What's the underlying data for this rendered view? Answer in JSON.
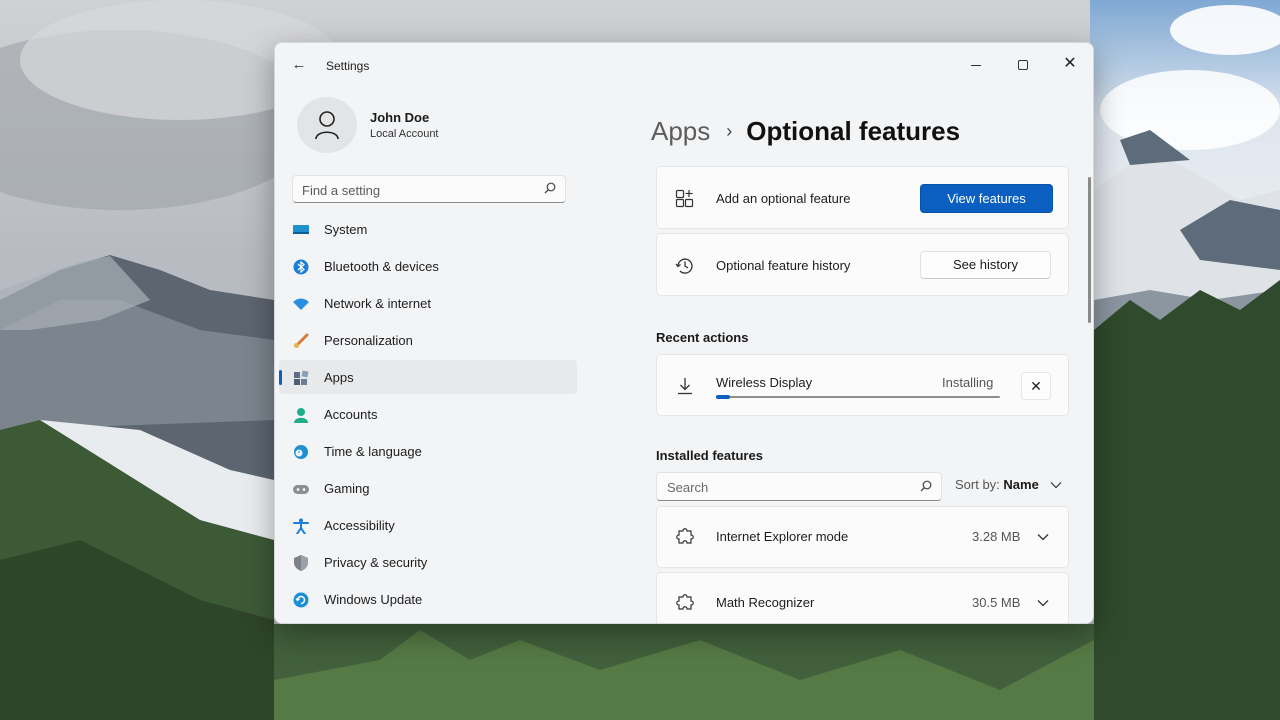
{
  "window": {
    "title": "Settings",
    "back_glyph": "←",
    "close_glyph": "✕"
  },
  "profile": {
    "name": "John Doe",
    "account_type": "Local Account"
  },
  "sidebar": {
    "search_placeholder": "Find a setting",
    "items": [
      {
        "label": "System",
        "icon": "system-icon",
        "color": "#1f8fd0"
      },
      {
        "label": "Bluetooth & devices",
        "icon": "bluetooth-icon",
        "color": "#1a7fd6"
      },
      {
        "label": "Network & internet",
        "icon": "wifi-icon",
        "color": "#2a8fe0"
      },
      {
        "label": "Personalization",
        "icon": "brush-icon",
        "color": "#d77a3a"
      },
      {
        "label": "Apps",
        "icon": "apps-icon",
        "color": "#4a6a8a",
        "active": true
      },
      {
        "label": "Accounts",
        "icon": "person-icon",
        "color": "#1fae8a"
      },
      {
        "label": "Time & language",
        "icon": "globe-clock-icon",
        "color": "#1f8fd0"
      },
      {
        "label": "Gaming",
        "icon": "gamepad-icon",
        "color": "#8a8f96"
      },
      {
        "label": "Accessibility",
        "icon": "accessibility-icon",
        "color": "#1a7fd6"
      },
      {
        "label": "Privacy & security",
        "icon": "shield-icon",
        "color": "#7d8288"
      },
      {
        "label": "Windows Update",
        "icon": "refresh-icon",
        "color": "#1a8fd6"
      }
    ]
  },
  "breadcrumb": {
    "parent": "Apps",
    "separator": "›",
    "current": "Optional features"
  },
  "add_feature": {
    "label": "Add an optional feature",
    "button": "View features"
  },
  "history": {
    "label": "Optional feature history",
    "button": "See history"
  },
  "recent": {
    "title": "Recent actions",
    "item": {
      "name": "Wireless Display",
      "status": "Installing",
      "progress": 0.05,
      "cancel_glyph": "✕"
    }
  },
  "installed": {
    "title": "Installed features",
    "search_placeholder": "Search",
    "sort_label": "Sort by:",
    "sort_value": "Name",
    "items": [
      {
        "name": "Internet Explorer mode",
        "size": "3.28 MB"
      },
      {
        "name": "Math Recognizer",
        "size": "30.5 MB"
      }
    ]
  },
  "colors": {
    "accent": "#0a5fc0",
    "window_bg": "#f3f4f6",
    "card_bg": "#fbfbfc"
  }
}
